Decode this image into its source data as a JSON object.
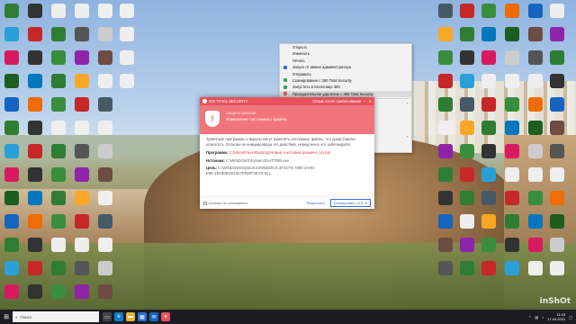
{
  "desktop": {
    "left_icons": [
      {
        "label": "",
        "color": "#2f7d32"
      },
      {
        "label": "",
        "color": "#333"
      },
      {
        "label": "",
        "color": "#eee"
      },
      {
        "label": "",
        "color": "#eee"
      },
      {
        "label": "",
        "color": "#eee"
      },
      {
        "label": "",
        "color": "#2aa0d8"
      },
      {
        "label": "",
        "color": "#c62828"
      },
      {
        "label": "",
        "color": "#2e7d32"
      },
      {
        "label": "",
        "color": "#555"
      },
      {
        "label": "",
        "color": "#ccc"
      },
      {
        "label": "",
        "color": "#d81b60"
      },
      {
        "label": "",
        "color": "#333"
      },
      {
        "label": "",
        "color": "#388e3c"
      },
      {
        "label": "",
        "color": "#8e24aa"
      },
      {
        "label": "",
        "color": "#6d4c41"
      },
      {
        "label": "",
        "color": "#1b5e20"
      },
      {
        "label": "",
        "color": "#0277bd"
      },
      {
        "label": "",
        "color": "#2e7d32"
      },
      {
        "label": "",
        "color": "#f9a825"
      },
      {
        "label": "",
        "color": "#eee"
      },
      {
        "label": "",
        "color": "#1565c0"
      },
      {
        "label": "",
        "color": "#ef6c00"
      },
      {
        "label": "",
        "color": "#388e3c"
      },
      {
        "label": "",
        "color": "#c62828"
      },
      {
        "label": "",
        "color": "#455a64"
      }
    ],
    "watermark": "inShOt",
    "datestamp": "17.04.2021"
  },
  "context_menu": {
    "items": [
      {
        "label": "Открыть",
        "color": "",
        "arrow": false
      },
      {
        "label": "Изменить",
        "color": "",
        "arrow": false
      },
      {
        "label": "Печать",
        "color": "",
        "arrow": false
      },
      {
        "label": "Запуск от имени администратора",
        "color": "#2e6fd6",
        "arrow": false
      },
      {
        "label": "Отправить",
        "color": "",
        "arrow": false
      },
      {
        "label": "Сканирование с 360 Total Security",
        "color": "#2aa84a",
        "arrow": false
      },
      {
        "label": "Запустить в песочнице 360",
        "color": "#2aa84a",
        "arrow": false
      },
      {
        "label": "Принудительное удаление с 360 Total Security",
        "color": "#e8525c",
        "arrow": false
      },
      {
        "label": "",
        "color": "",
        "arrow": true
      },
      {
        "label": "",
        "color": "",
        "arrow": false
      },
      {
        "label": "",
        "color": "",
        "arrow": false
      },
      {
        "label": "",
        "color": "",
        "arrow": false
      },
      {
        "label": "email",
        "color": "",
        "arrow": false
      },
      {
        "label": "",
        "color": "",
        "arrow": true
      },
      {
        "label": "",
        "color": "",
        "arrow": false
      }
    ]
  },
  "dialog": {
    "app_title": "360 TOTAL SECURITY",
    "header_link": "Отзыв после срабатывания",
    "category": "Защита файлов",
    "title": "Изменение системного файла",
    "description": "Троянские программы и вирусы могут изменять системные файлы, что представляет опасность. Если вы не инициировали это действие, немедленно его заблокируйте",
    "program_label": "Программа:",
    "program_value": "C:\\Users\\Pavel\\Desktop\\Новый текстовый документ (4).bat",
    "source_label": "Источник:",
    "source_value": "C:\\WINDOWS\\System32\\ATTRIB.exe",
    "target_label": "Цель:",
    "target_value": "C:\\WINDOWS\\system32\\WBEM\\C8 ЗГОСТБ-7885-4АЯО-Е9Е-1B1B08OD19СЯЯ\\МРЭЕАЯ.DLL",
    "remember_label": "Больше не напоминать",
    "allow_label": "Разрешить",
    "block_label": "Блокировать (20)"
  },
  "taskbar": {
    "search_placeholder": "Поиск",
    "clock_time": "11:15",
    "clock_date": "17.04.2021"
  }
}
